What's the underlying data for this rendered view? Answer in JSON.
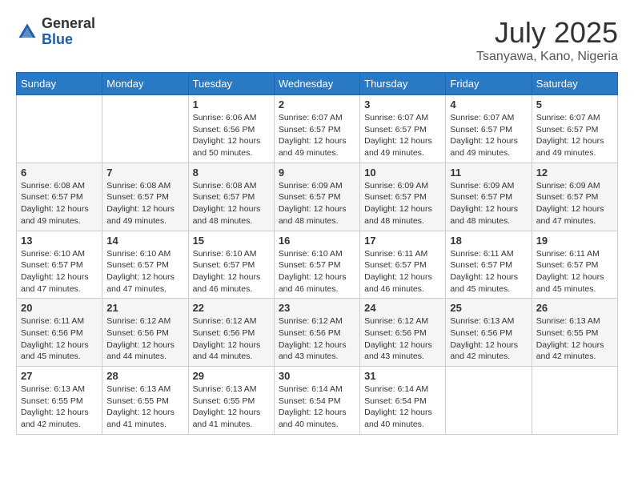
{
  "header": {
    "logo_general": "General",
    "logo_blue": "Blue",
    "month_title": "July 2025",
    "location": "Tsanyawa, Kano, Nigeria"
  },
  "weekdays": [
    "Sunday",
    "Monday",
    "Tuesday",
    "Wednesday",
    "Thursday",
    "Friday",
    "Saturday"
  ],
  "weeks": [
    [
      {
        "day": "",
        "info": ""
      },
      {
        "day": "",
        "info": ""
      },
      {
        "day": "1",
        "info": "Sunrise: 6:06 AM\nSunset: 6:56 PM\nDaylight: 12 hours and 50 minutes."
      },
      {
        "day": "2",
        "info": "Sunrise: 6:07 AM\nSunset: 6:57 PM\nDaylight: 12 hours and 49 minutes."
      },
      {
        "day": "3",
        "info": "Sunrise: 6:07 AM\nSunset: 6:57 PM\nDaylight: 12 hours and 49 minutes."
      },
      {
        "day": "4",
        "info": "Sunrise: 6:07 AM\nSunset: 6:57 PM\nDaylight: 12 hours and 49 minutes."
      },
      {
        "day": "5",
        "info": "Sunrise: 6:07 AM\nSunset: 6:57 PM\nDaylight: 12 hours and 49 minutes."
      }
    ],
    [
      {
        "day": "6",
        "info": "Sunrise: 6:08 AM\nSunset: 6:57 PM\nDaylight: 12 hours and 49 minutes."
      },
      {
        "day": "7",
        "info": "Sunrise: 6:08 AM\nSunset: 6:57 PM\nDaylight: 12 hours and 49 minutes."
      },
      {
        "day": "8",
        "info": "Sunrise: 6:08 AM\nSunset: 6:57 PM\nDaylight: 12 hours and 48 minutes."
      },
      {
        "day": "9",
        "info": "Sunrise: 6:09 AM\nSunset: 6:57 PM\nDaylight: 12 hours and 48 minutes."
      },
      {
        "day": "10",
        "info": "Sunrise: 6:09 AM\nSunset: 6:57 PM\nDaylight: 12 hours and 48 minutes."
      },
      {
        "day": "11",
        "info": "Sunrise: 6:09 AM\nSunset: 6:57 PM\nDaylight: 12 hours and 48 minutes."
      },
      {
        "day": "12",
        "info": "Sunrise: 6:09 AM\nSunset: 6:57 PM\nDaylight: 12 hours and 47 minutes."
      }
    ],
    [
      {
        "day": "13",
        "info": "Sunrise: 6:10 AM\nSunset: 6:57 PM\nDaylight: 12 hours and 47 minutes."
      },
      {
        "day": "14",
        "info": "Sunrise: 6:10 AM\nSunset: 6:57 PM\nDaylight: 12 hours and 47 minutes."
      },
      {
        "day": "15",
        "info": "Sunrise: 6:10 AM\nSunset: 6:57 PM\nDaylight: 12 hours and 46 minutes."
      },
      {
        "day": "16",
        "info": "Sunrise: 6:10 AM\nSunset: 6:57 PM\nDaylight: 12 hours and 46 minutes."
      },
      {
        "day": "17",
        "info": "Sunrise: 6:11 AM\nSunset: 6:57 PM\nDaylight: 12 hours and 46 minutes."
      },
      {
        "day": "18",
        "info": "Sunrise: 6:11 AM\nSunset: 6:57 PM\nDaylight: 12 hours and 45 minutes."
      },
      {
        "day": "19",
        "info": "Sunrise: 6:11 AM\nSunset: 6:57 PM\nDaylight: 12 hours and 45 minutes."
      }
    ],
    [
      {
        "day": "20",
        "info": "Sunrise: 6:11 AM\nSunset: 6:56 PM\nDaylight: 12 hours and 45 minutes."
      },
      {
        "day": "21",
        "info": "Sunrise: 6:12 AM\nSunset: 6:56 PM\nDaylight: 12 hours and 44 minutes."
      },
      {
        "day": "22",
        "info": "Sunrise: 6:12 AM\nSunset: 6:56 PM\nDaylight: 12 hours and 44 minutes."
      },
      {
        "day": "23",
        "info": "Sunrise: 6:12 AM\nSunset: 6:56 PM\nDaylight: 12 hours and 43 minutes."
      },
      {
        "day": "24",
        "info": "Sunrise: 6:12 AM\nSunset: 6:56 PM\nDaylight: 12 hours and 43 minutes."
      },
      {
        "day": "25",
        "info": "Sunrise: 6:13 AM\nSunset: 6:56 PM\nDaylight: 12 hours and 42 minutes."
      },
      {
        "day": "26",
        "info": "Sunrise: 6:13 AM\nSunset: 6:55 PM\nDaylight: 12 hours and 42 minutes."
      }
    ],
    [
      {
        "day": "27",
        "info": "Sunrise: 6:13 AM\nSunset: 6:55 PM\nDaylight: 12 hours and 42 minutes."
      },
      {
        "day": "28",
        "info": "Sunrise: 6:13 AM\nSunset: 6:55 PM\nDaylight: 12 hours and 41 minutes."
      },
      {
        "day": "29",
        "info": "Sunrise: 6:13 AM\nSunset: 6:55 PM\nDaylight: 12 hours and 41 minutes."
      },
      {
        "day": "30",
        "info": "Sunrise: 6:14 AM\nSunset: 6:54 PM\nDaylight: 12 hours and 40 minutes."
      },
      {
        "day": "31",
        "info": "Sunrise: 6:14 AM\nSunset: 6:54 PM\nDaylight: 12 hours and 40 minutes."
      },
      {
        "day": "",
        "info": ""
      },
      {
        "day": "",
        "info": ""
      }
    ]
  ]
}
